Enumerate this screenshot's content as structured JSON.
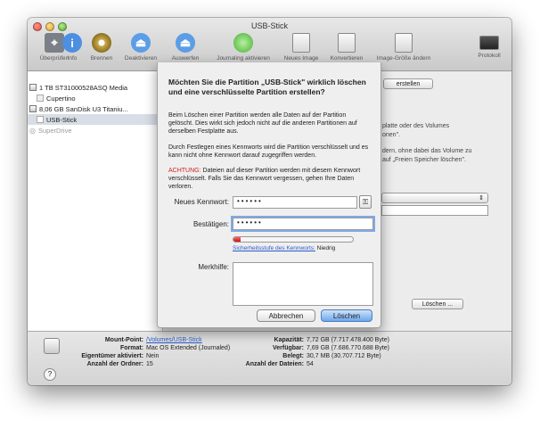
{
  "window": {
    "title": "USB-Stick"
  },
  "toolbar": {
    "items": [
      {
        "label": "Überprüfen",
        "icon": "microscope-icon"
      },
      {
        "label": "Info",
        "icon": "info-icon"
      },
      {
        "label": "Brennen",
        "icon": "burn-icon"
      },
      {
        "label": "Deaktivieren",
        "icon": "eject-icon"
      },
      {
        "label": "Auswerfen",
        "icon": "eject-icon"
      },
      {
        "label": "Journaling aktivieren",
        "icon": "journaling-icon"
      },
      {
        "label": "Neues Image",
        "icon": "new-image-icon"
      },
      {
        "label": "Konvertieren",
        "icon": "convert-icon"
      },
      {
        "label": "Image-Größe ändern",
        "icon": "resize-image-icon"
      },
      {
        "label": "Protokoll",
        "icon": "log-icon"
      }
    ]
  },
  "sidebar": {
    "items": [
      {
        "label": "1 TB ST31000528ASQ Media"
      },
      {
        "label": "Cupertino"
      },
      {
        "label": "8,06 GB SanDisk U3 Titaniu..."
      },
      {
        "label": "USB-Stick"
      },
      {
        "label": "SuperDrive"
      }
    ]
  },
  "background": {
    "erstellen_label": "erstellen",
    "text1": "platte oder des Volumes",
    "text2": "onen\".",
    "text3": "dern, ohne dabei das Volume zu",
    "text4": "auf „Freien Speicher löschen\".",
    "loeschen_label": "Löschen ..."
  },
  "dialog": {
    "title": "Möchten Sie die Partition „USB-Stick\" wirklich löschen und eine verschlüsselte Partition erstellen?",
    "para1": "Beim Löschen einer Partition werden alle Daten auf der Partition gelöscht. Dies wirkt sich jedoch nicht auf die anderen Partitionen auf derselben Festplatte aus.",
    "para2": "Durch Festlegen eines Kennworts wird die Partition verschlüsselt und es kann nicht ohne Kennwort darauf zugegriffen werden.",
    "warning_label": "ACHTUNG:",
    "warning_text": "Dateien auf dieser Partition werden mit diesem Kennwort verschlüsselt. Falls Sie das Kennwort vergessen, gehen Ihre Daten verloren.",
    "password_label": "Neues Kennwort:",
    "password_value": "••••••",
    "confirm_label": "Bestätigen:",
    "confirm_value": "••••••",
    "strength_fraction": 0.06,
    "strength_link": "Sicherheitsstufe des Kennworts:",
    "strength_value": "Niedrig",
    "hint_label": "Merkhilfe:",
    "hint_value": "",
    "cancel_label": "Abbrechen",
    "erase_label": "Löschen"
  },
  "info": {
    "mount_point_label": "Mount-Point:",
    "mount_point_value": "/Volumes/USB-Stick",
    "format_label": "Format:",
    "format_value": "Mac OS Extended (Journaled)",
    "owners_label": "Eigentümer aktiviert:",
    "owners_value": "Nein",
    "folders_label": "Anzahl der Ordner:",
    "folders_value": "15",
    "capacity_label": "Kapazität:",
    "capacity_value": "7,72 GB (7.717.478.400 Byte)",
    "available_label": "Verfügbar:",
    "available_value": "7,69 GB (7.686.770.688 Byte)",
    "used_label": "Belegt:",
    "used_value": "30,7 MB (30.707.712 Byte)",
    "files_label": "Anzahl der Dateien:",
    "files_value": "54",
    "help_glyph": "?"
  }
}
